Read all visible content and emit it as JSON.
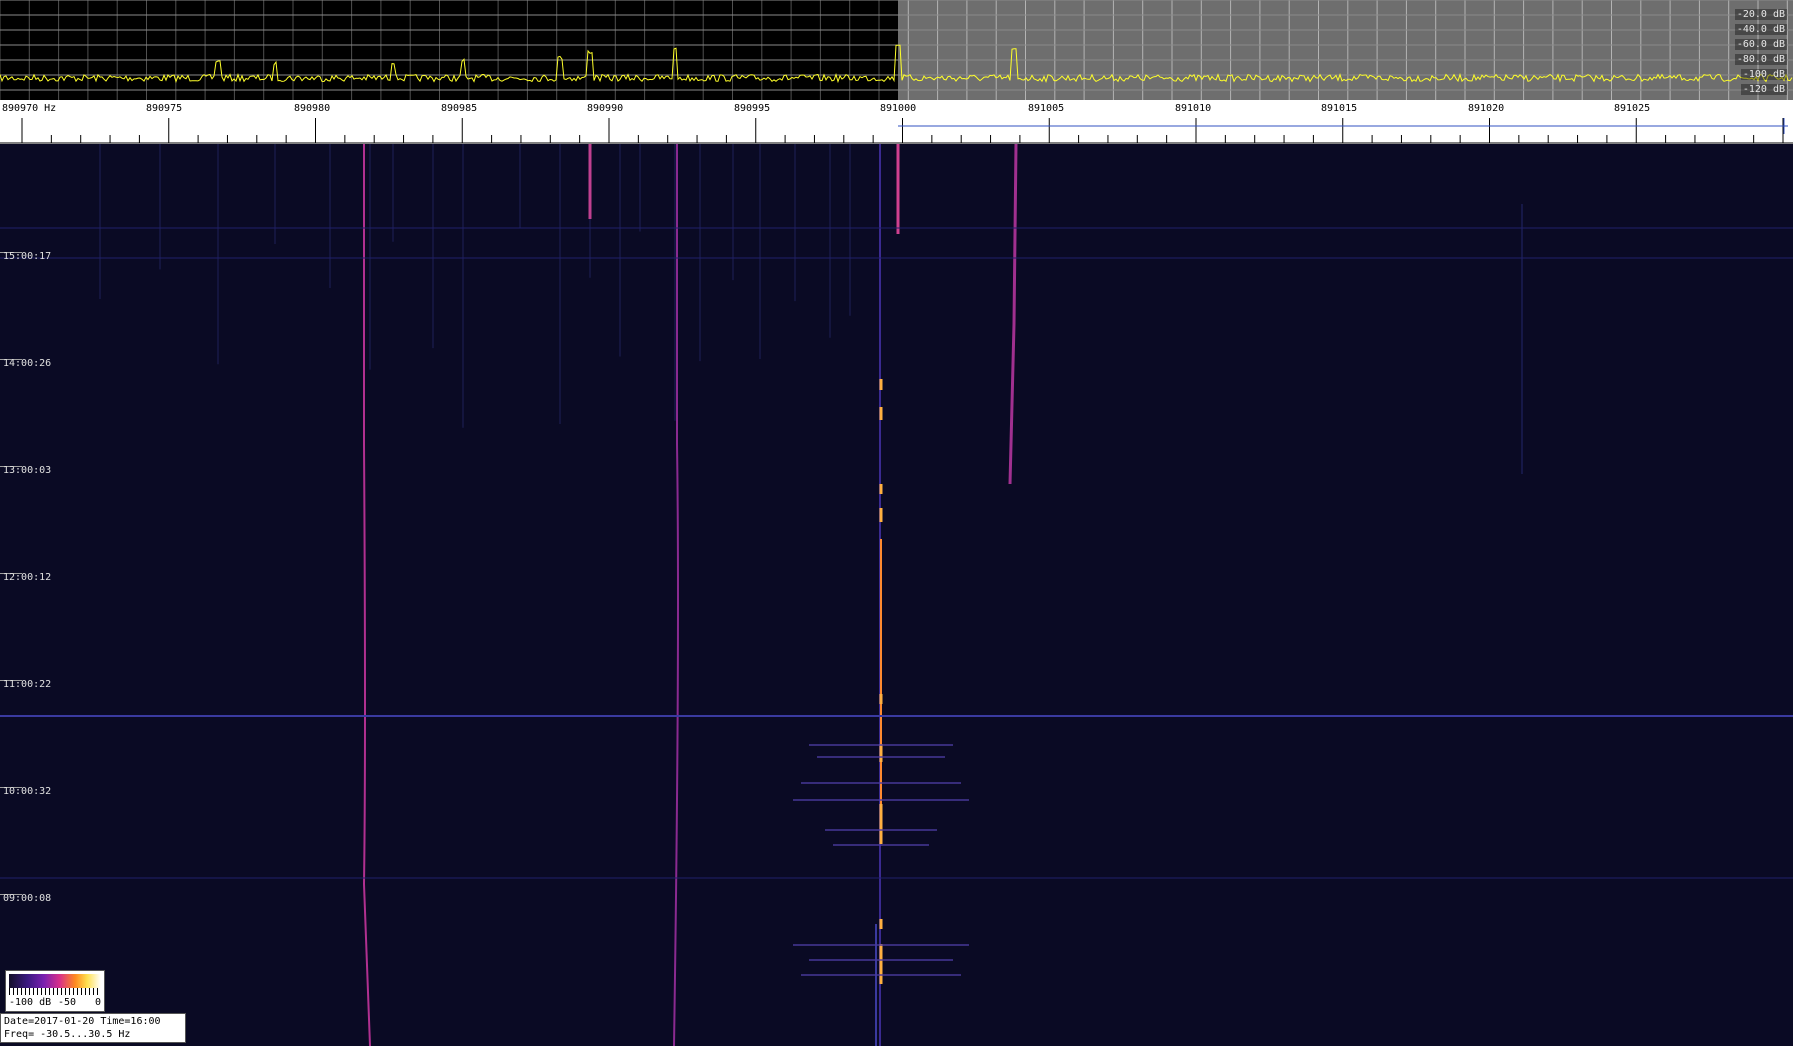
{
  "spectrum": {
    "db_labels": [
      "-20.0 dB",
      "-40.0 dB",
      "-60.0 dB",
      "-80.0 dB",
      "-100 dB",
      "-120 dB"
    ],
    "trace_color": "#ffff2a",
    "left_panel_color": "#000000",
    "right_panel_color": "#6e6e6e",
    "grid_color": "#b4b4b4"
  },
  "frequency_axis": {
    "labels": [
      "890970 Hz",
      "890975",
      "890980",
      "890985",
      "890990",
      "890995",
      "891000",
      "891005",
      "891010",
      "891015",
      "891020",
      "891025"
    ]
  },
  "waterfall": {
    "background_color": "#0a0a24",
    "time_labels": [
      "15:00:17",
      "14:00:26",
      "13:00:03",
      "12:00:12",
      "11:00:22",
      "10:00:32",
      "09:00:08"
    ]
  },
  "colorbar": {
    "labels": [
      "-100 dB",
      "-50",
      "0"
    ]
  },
  "info": {
    "date_line": "Date=2017-01-20 Time=16:00",
    "freq_line": "Freq= -30.5...30.5 Hz"
  }
}
